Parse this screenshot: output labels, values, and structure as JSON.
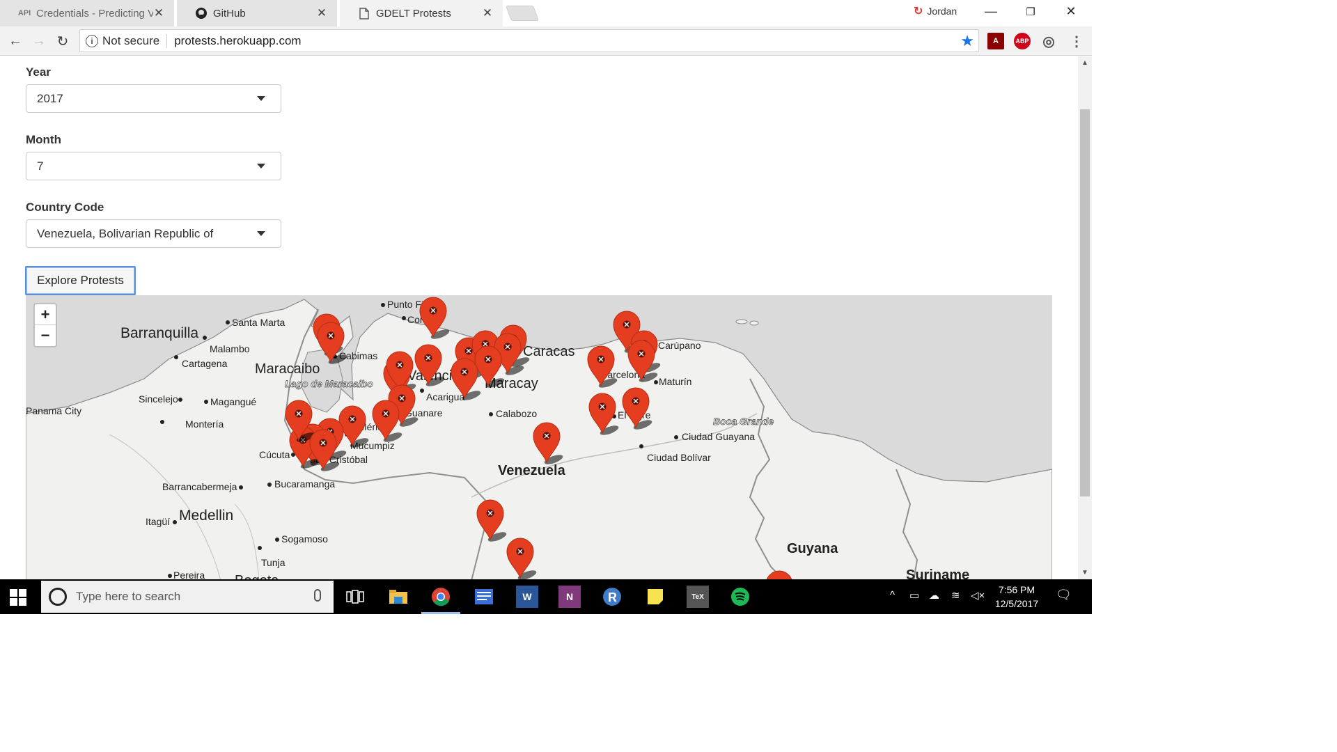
{
  "browser": {
    "tabs": [
      {
        "title": "Credentials - Predicting V",
        "icon": "api-icon",
        "icon_text": "API",
        "active": false
      },
      {
        "title": "GitHub",
        "icon": "github-icon",
        "active": false
      },
      {
        "title": "GDELT Protests",
        "icon": "page-icon",
        "active": true
      }
    ],
    "profile_name": "Jordan",
    "security_label": "Not secure",
    "url": "protests.herokuapp.com",
    "ext_acrobat": "A",
    "ext_abp": "ABP",
    "accent_color": "#1a73e8"
  },
  "form": {
    "year_label": "Year",
    "year_value": "2017",
    "month_label": "Month",
    "month_value": "7",
    "country_label": "Country Code",
    "country_value": "Venezuela, Bolivarian Republic of",
    "submit_label": "Explore Protests"
  },
  "map": {
    "zoom_in": "+",
    "zoom_out": "−",
    "marker_color": "#e53d1f",
    "place_labels": [
      "Barranquilla",
      "Santa Marta",
      "Malambo",
      "Cartagena",
      "Maracaibo",
      "Lago de Maracaibo",
      "Cabimas",
      "Punto Fijo",
      "Coro",
      "Valencia",
      "Maracay",
      "Caracas",
      "Acarigua",
      "Guanare",
      "Calabozo",
      "Barcelona",
      "Carúpano",
      "Maturín",
      "El Tigre",
      "Boca Grande",
      "Ciudad Guayana",
      "Ciudad Bolívar",
      "Venezuela",
      "Sincelejo",
      "Magangué",
      "Montería",
      "Panama City",
      "Cúcuta",
      "San Cristóbal",
      "Mérida",
      "Mucumpiz",
      "Barrancabermeja",
      "Bucaramanga",
      "Itagüí",
      "Medellin",
      "Sogamoso",
      "Tunja",
      "Pereira",
      "Bogota",
      "Guyana",
      "Suriname"
    ]
  },
  "taskbar": {
    "search_placeholder": "Type here to search",
    "time": "7:56 PM",
    "date": "12/5/2017",
    "pinned_apps": [
      "task-view",
      "file-explorer",
      "chrome",
      "presentation",
      "word",
      "onenote",
      "r",
      "sticky-notes",
      "texmaker",
      "spotify"
    ]
  }
}
